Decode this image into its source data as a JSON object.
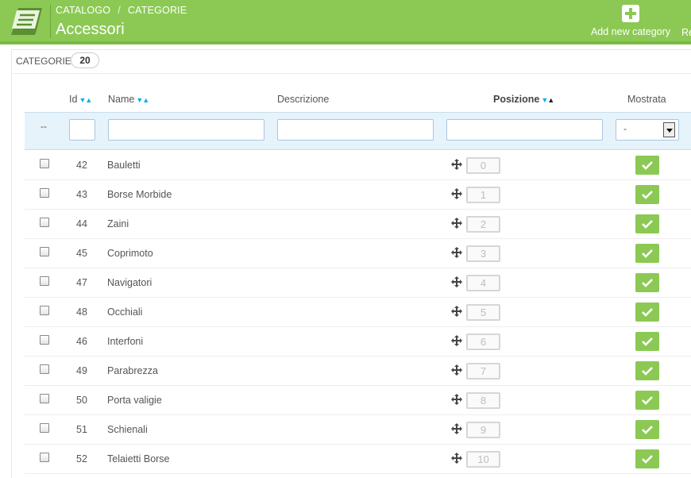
{
  "breadcrumb": {
    "level1": "CATALOGO",
    "separator": "/",
    "level2": "CATEGORIE"
  },
  "page_title": "Accessori",
  "toolbar": {
    "add_label": "Add new category",
    "second_label": "Re"
  },
  "panel": {
    "title": "CATEGORIE",
    "count": "20"
  },
  "columns": {
    "id": "Id",
    "name": "Name",
    "description": "Descrizione",
    "position": "Posizione",
    "shown": "Mostrata"
  },
  "sort_glyphs": {
    "down": "▼",
    "up": "▲"
  },
  "filter": {
    "dash": "--",
    "shown_value": "-"
  },
  "rows": [
    {
      "id": "42",
      "name": "Bauletti",
      "position": "0",
      "shown": true
    },
    {
      "id": "43",
      "name": "Borse Morbide",
      "position": "1",
      "shown": true
    },
    {
      "id": "44",
      "name": "Zaini",
      "position": "2",
      "shown": true
    },
    {
      "id": "45",
      "name": "Coprimoto",
      "position": "3",
      "shown": true
    },
    {
      "id": "47",
      "name": "Navigatori",
      "position": "4",
      "shown": true
    },
    {
      "id": "48",
      "name": "Occhiali",
      "position": "5",
      "shown": true
    },
    {
      "id": "46",
      "name": "Interfoni",
      "position": "6",
      "shown": true
    },
    {
      "id": "49",
      "name": "Parabrezza",
      "position": "7",
      "shown": true
    },
    {
      "id": "50",
      "name": "Porta valigie",
      "position": "8",
      "shown": true
    },
    {
      "id": "51",
      "name": "Schienali",
      "position": "9",
      "shown": true
    },
    {
      "id": "52",
      "name": "Telaietti Borse",
      "position": "10",
      "shown": true
    }
  ],
  "colors": {
    "header_green": "#8bc954",
    "accent_blue": "#00aff0",
    "filter_bg": "#e6f3fb"
  },
  "icons": {
    "logo": "book-icon",
    "add": "plus-icon",
    "drag": "move-icon",
    "shown": "check-icon",
    "sort": "sort-arrows-icon",
    "select": "chevron-down-icon"
  }
}
